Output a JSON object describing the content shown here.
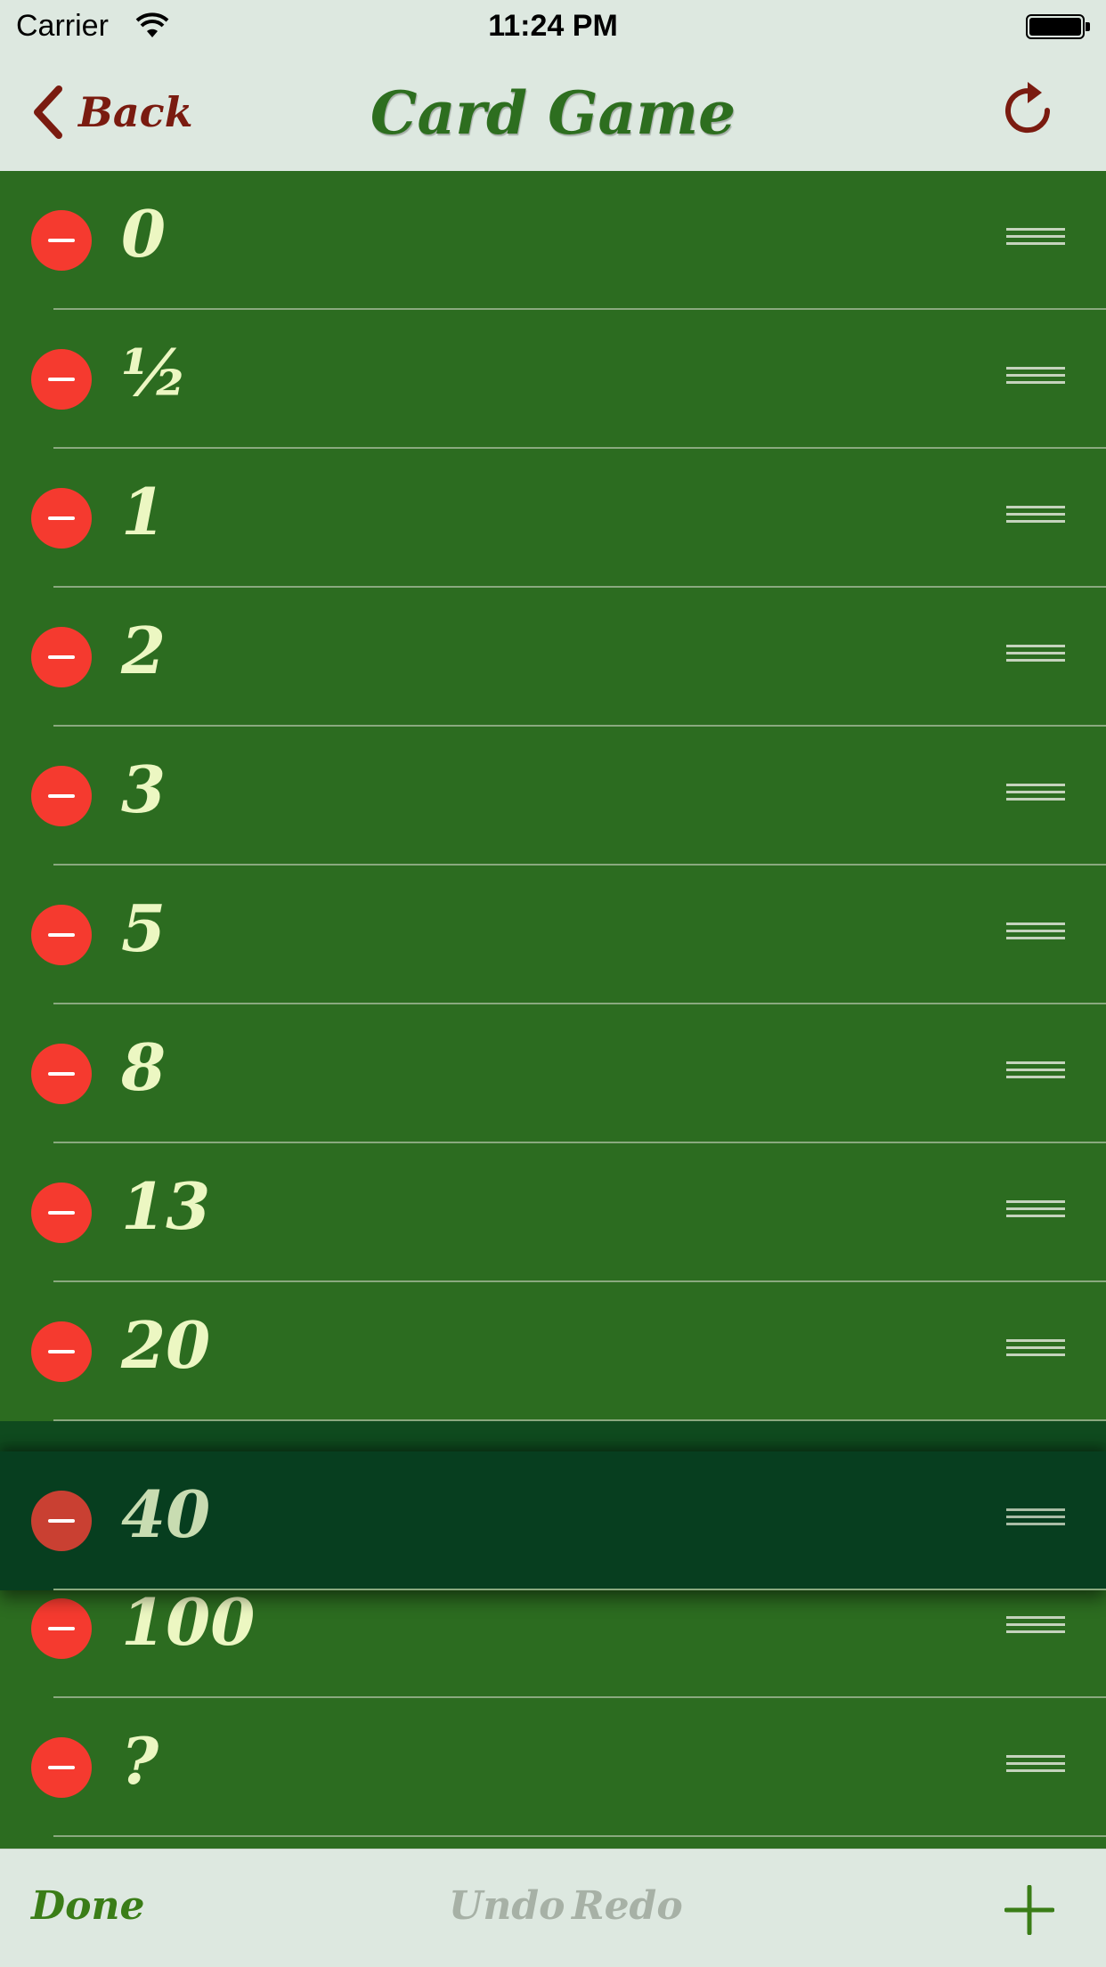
{
  "status_bar": {
    "carrier": "Carrier",
    "time": "11:24 PM"
  },
  "nav": {
    "back_label": "Back",
    "title": "Card Game"
  },
  "cards": [
    {
      "value": "0"
    },
    {
      "value": "½"
    },
    {
      "value": "1"
    },
    {
      "value": "2"
    },
    {
      "value": "3"
    },
    {
      "value": "5"
    },
    {
      "value": "8"
    },
    {
      "value": "13"
    },
    {
      "value": "20"
    },
    {
      "value": "40",
      "dragging": true
    },
    {
      "value": "100"
    },
    {
      "value": "?"
    }
  ],
  "toolbar": {
    "done_label": "Done",
    "undo_label": "Undo",
    "redo_label": "Redo"
  },
  "colors": {
    "bar_background": "#dde8e0",
    "list_background": "#2c6c20",
    "drag_row": "#073e1f",
    "delete_red": "#f53a2f",
    "value_text": "#ecf7c2",
    "back_red": "#7a1b10",
    "title_green": "#2d6e1f",
    "disabled_gray": "#a7b1a6"
  },
  "icons": [
    "wifi-icon",
    "battery-icon",
    "back-chevron-icon",
    "refresh-icon",
    "delete-icon",
    "reorder-grip-icon",
    "add-icon"
  ]
}
